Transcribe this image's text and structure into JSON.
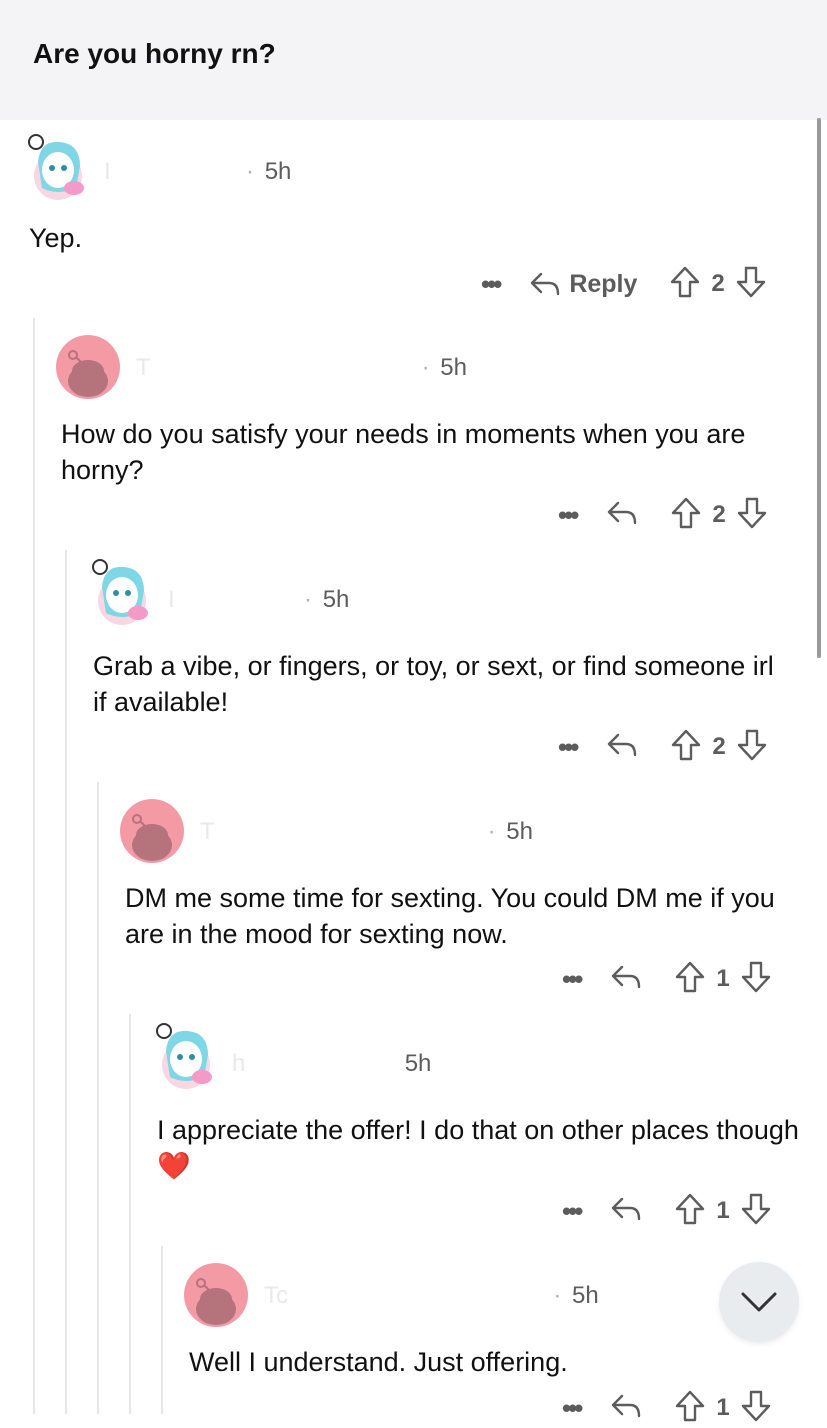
{
  "header": {
    "title": "Are you horny rn?"
  },
  "comments": [
    {
      "username": "I",
      "dot": "·",
      "time": "5h",
      "text": "Yep.",
      "reply_label": "Reply",
      "votes": "2",
      "avatar": "anime-icon"
    },
    {
      "username": "T",
      "dot": "·",
      "time": "5h",
      "text": "How do you satisfy your needs in moments when you are horny?",
      "votes": "2",
      "avatar": "snoo-icon"
    },
    {
      "username": "I",
      "dot": "·",
      "time": "5h",
      "text": "Grab a vibe, or fingers, or toy, or sext, or find someone irl if available!",
      "votes": "2",
      "avatar": "anime-icon"
    },
    {
      "username": "T",
      "dot": "·",
      "time": "5h",
      "text": "DM me some time for sexting. You could DM me if you are in the mood for sexting now.",
      "votes": "1",
      "avatar": "snoo-icon"
    },
    {
      "username": "h",
      "dot": "",
      "time": "5h",
      "text": "I appreciate the offer! I do that on other places though",
      "emoji": "❤️",
      "votes": "1",
      "avatar": "anime-icon"
    },
    {
      "username": "Tc",
      "dot": "·",
      "time": "5h",
      "text": "Well I understand. Just offering.",
      "votes": "1",
      "avatar": "snoo-icon"
    }
  ],
  "more_label": "•••",
  "colors": {
    "snoo_bg": "#f49aa4",
    "snoo_fg": "#b5737b",
    "thread_line": "#e6e6e9"
  }
}
